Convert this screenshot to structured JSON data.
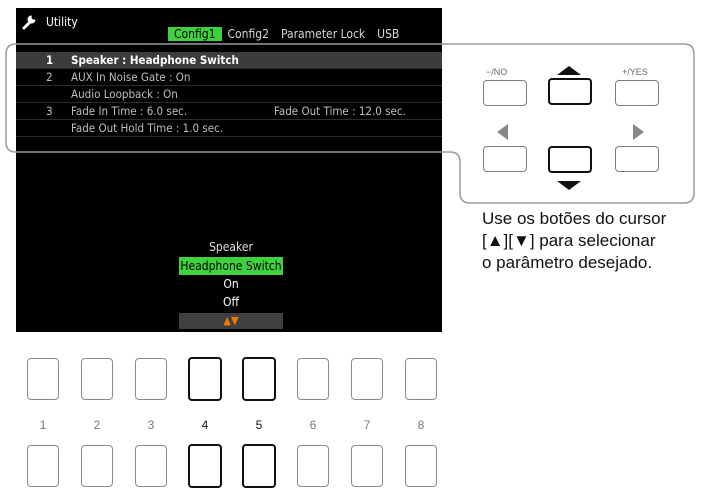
{
  "screen": {
    "title": "Utility",
    "tabs": [
      {
        "label": "Config1",
        "active": true
      },
      {
        "label": "Config2",
        "active": false
      },
      {
        "label": "Parameter Lock",
        "active": false
      },
      {
        "label": "USB",
        "active": false
      }
    ],
    "rows": [
      {
        "num": "1",
        "label": "Speaker : Headphone Switch",
        "label2": "",
        "selected": true
      },
      {
        "num": "2",
        "label": "AUX In Noise Gate : On",
        "label2": "",
        "selected": false
      },
      {
        "num": "",
        "label": "Audio Loopback : On",
        "label2": "",
        "selected": false
      },
      {
        "num": "3",
        "label": "Fade In Time : 6.0 sec.",
        "label2": "Fade Out Time : 12.0 sec.",
        "selected": false
      },
      {
        "num": "",
        "label": "Fade Out Hold Time : 1.0 sec.",
        "label2": "",
        "selected": false
      }
    ],
    "popup": {
      "title": "Speaker",
      "options": [
        "Headphone Switch",
        "On",
        "Off"
      ],
      "selected_index": 0,
      "arrows": "▲▼"
    },
    "accent_green": "#3ed23e",
    "accent_orange": "#f07a00"
  },
  "cursor_panel": {
    "no_label": "−/NO",
    "yes_label": "+/YES"
  },
  "callout": {
    "text": "Use os botões do cursor\n[▲][▼] para selecionar\no parâmetro desejado."
  },
  "bottom_buttons": {
    "numbers": [
      "1",
      "2",
      "3",
      "4",
      "5",
      "6",
      "7",
      "8"
    ],
    "active": [
      "4",
      "5"
    ]
  }
}
